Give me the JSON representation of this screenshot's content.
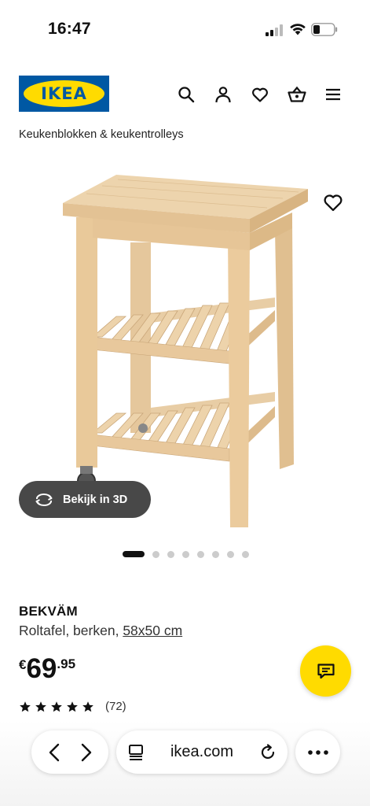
{
  "status_bar": {
    "time": "16:47"
  },
  "header": {
    "logo_text": "IKEA",
    "icons": [
      "search-icon",
      "user-icon",
      "heart-icon",
      "basket-icon",
      "menu-icon"
    ]
  },
  "breadcrumb": "Keukenblokken & keukentrolleys",
  "image": {
    "view_3d_label": "Bekijk in 3D",
    "carousel": {
      "total": 8,
      "active": 1
    }
  },
  "product": {
    "name": "BEKVÄM",
    "description": "Roltafel, berken,",
    "size": "58x50 cm",
    "price": {
      "currency": "€",
      "integer": "69",
      "decimal": ".95"
    },
    "rating": {
      "stars": 5,
      "count": "(72)"
    }
  },
  "browser": {
    "url": "ikea.com"
  },
  "colors": {
    "ikea_blue": "#0058a3",
    "ikea_yellow": "#ffdb00",
    "pill_dark": "#484848"
  }
}
